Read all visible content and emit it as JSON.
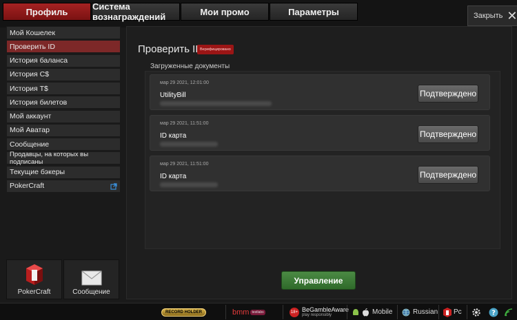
{
  "tabs": [
    {
      "label": "Профиль",
      "active": true
    },
    {
      "label": "Система вознаграждений",
      "active": false
    },
    {
      "label": "Мои промо",
      "active": false
    },
    {
      "label": "Параметры",
      "active": false
    }
  ],
  "close_label": "Закрыть",
  "sidebar": {
    "items": [
      {
        "label": "Мой Кошелек"
      },
      {
        "label": "Проверить ID",
        "active": true
      },
      {
        "label": "История баланса"
      },
      {
        "label": "История С$"
      },
      {
        "label": "История Т$"
      },
      {
        "label": "История билетов"
      },
      {
        "label": "Мой аккаунт"
      },
      {
        "label": "Мой Аватар"
      },
      {
        "label": "Сообщение"
      },
      {
        "label": "Продавцы, на которых вы подписаны"
      },
      {
        "label": "Текущие бэкеры"
      },
      {
        "label": "PokerCraft"
      }
    ],
    "tiles": [
      {
        "label": "PokerCraft",
        "icon": "pokercraft-icon"
      },
      {
        "label": "Сообщение",
        "icon": "envelope-icon"
      }
    ]
  },
  "main": {
    "title": "Проверить ID",
    "badge": "Верифицировано",
    "section_label": "Загруженные документы",
    "documents": [
      {
        "date": "мар 29 2021, 12:01:00",
        "name": "UtilityBill",
        "status": "Подтверждено"
      },
      {
        "date": "мар 29 2021, 11:51:00",
        "name": "ID карта",
        "status": "Подтверждено"
      },
      {
        "date": "мар 29 2021, 11:51:00",
        "name": "ID карта",
        "status": "Подтверждено"
      }
    ],
    "manage_button": "Управление"
  },
  "bottom_bar": {
    "record_holder": "RECORD HOLDER",
    "bmm": "bmm",
    "bmm_sub": "testlabs",
    "age": "18+",
    "begamble_title": "BeGambleAware",
    "begamble_sub": "play responsibly",
    "mobile": "Mobile",
    "language": "Russian",
    "pc": "Pc"
  },
  "colors": {
    "accent_red": "#8b1a1a",
    "manage_green": "#3a7a33",
    "sidebar_active": "#7d2828"
  }
}
